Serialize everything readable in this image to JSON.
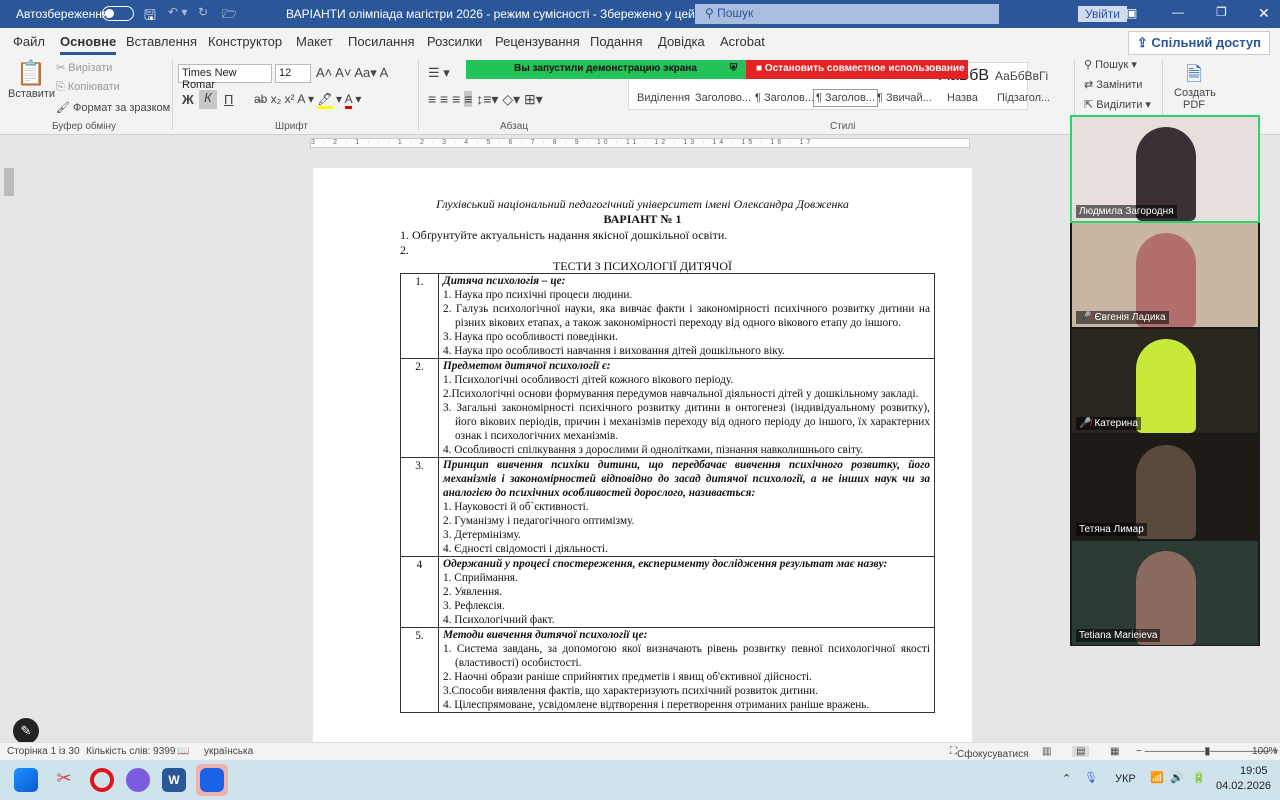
{
  "titlebar": {
    "autosave": "Автозбереження",
    "doc_title": "ВАРІАНТИ олімпіада  магістри 2026  -  режим сумісності  -  Збережено у цей ПК ▾",
    "search_placeholder": "Пошук",
    "login": "Увійти"
  },
  "tabs": [
    "Файл",
    "Основне",
    "Вставлення",
    "Конструктор",
    "Макет",
    "Посилання",
    "Розсилки",
    "Рецензування",
    "Подання",
    "Довідка",
    "Acrobat"
  ],
  "share": "Спільний доступ",
  "ribbon": {
    "paste": "Вставити",
    "cut": "Вирізати",
    "copy": "Копіювати",
    "format_painter": "Формат за зразком",
    "clipboard": "Буфер обміну",
    "font_name": "Times New Romar",
    "font_size": "12",
    "font_group": "Шрифт",
    "paragraph_group": "Абзац",
    "styles_group": "Стилі",
    "styles": [
      "Виділення",
      "Заголово...",
      "¶ Заголов...",
      "¶ Заголов...",
      "¶ Звичай...",
      "Назва",
      "Підзагол..."
    ],
    "style_sample_name": "АаБбВ",
    "style_sample_sub": "АаБбВвГі",
    "find": "Пошук",
    "replace": "Замінити",
    "select": "Виділити",
    "create_pdf": "Создать PDF",
    "bold": "Ж",
    "italic": "К",
    "underline": "П"
  },
  "screenshare": {
    "sharing_msg": "Вы запустили демонстрацию экрана",
    "stop": "Остановить совместное использование"
  },
  "ruler": "3 · 2 · 1 · · · 1 · 2 · 3 · 4 · 5 · 6 · 7 · 8 · 9 · 10 · 11 · 12 · 13 · 14 · 15 · 16 · 17",
  "document": {
    "university": "Глухівський національний педагогічний  університет імені Олександра Довженка",
    "variant": "ВАРІАНТ  № 1",
    "task1": "1. Обґрунтуйте актуальність надання якісної дошкільної освіти.",
    "task2": "2.",
    "section": "ТЕСТИ З ПСИХОЛОГІЇ ДИТЯЧОЇ",
    "questions": [
      {
        "num": "1.",
        "q": "Дитяча психологія – це:",
        "options": [
          "1. Наука про психічні процеси людини.",
          "2. Галузь психологічної науки, яка вивчає факти і закономірності психічного розвитку дитини на різних вікових етапах, а також закономірності переходу від одного вікового етапу до іншого.",
          "3. Наука про особливості поведінки.",
          "4. Наука про особливості навчання і виховання дітей дошкільного віку."
        ]
      },
      {
        "num": "2.",
        "q": "Предметом дитячої психології є:",
        "options": [
          "1. Психологічні особливості дітей кожного вікового періоду.",
          "2.Психологічні основи формування передумов навчальної діяльності дітей у дошкільному закладі.",
          "3. Загальні закономірності психічного розвитку дитини в онтогенезі (індивідуальному розвитку), його вікових періодів, причин і механізмів переходу від одного періоду до іншого, їх характерних ознак і психологічних механізмів.",
          "4. Особливості спілкування з дорослими й однолітками, пізнання навколишнього світу."
        ]
      },
      {
        "num": "3.",
        "q": "Принцип вивчення психіки дитини, що передбачає вивчення психічного розвитку, його механізмів і закономірностей відповідно до засад дитячої психології, а не інших наук чи за аналогією до психічних особливостей дорослого, називається:",
        "options": [
          "1. Науковості й об`єктивності.",
          "2. Гуманізму і педагогічного оптимізму.",
          "3. Детермінізму.",
          "4. Єдності свідомості і діяльності."
        ]
      },
      {
        "num": "4",
        "q": "Одержаний у процесі спостереження, експерименту дослідження результат має назву:",
        "options": [
          "1. Сприймання.",
          "2. Уявлення.",
          "3. Рефлексія.",
          "4. Психологічний факт."
        ]
      },
      {
        "num": "5.",
        "q": "Методи вивчення дитячої психології це:",
        "options": [
          "1. Система завдань, за допомогою якої визначають рівень розвитку певної психологічної якості (властивості) особистості.",
          "2. Наочні образи раніше сприйнятих предметів і явищ об'єктивної дійсності.",
          "3.Способи виявлення фактів, що характеризують психічний розвиток дитини.",
          "4. Цілеспрямоване, усвідомлене відтворення і перетворення отриманих раніше вражень."
        ]
      }
    ]
  },
  "participants": [
    {
      "name": "Людмила Загородня",
      "muted": false,
      "bg": "#e9dede",
      "face": "#3a3036"
    },
    {
      "name": "Євгенія Ладика",
      "muted": true,
      "bg": "#c9b7a4",
      "face": "#b26f6c"
    },
    {
      "name": "Катерина",
      "muted": true,
      "bg": "#2a2620",
      "face": "#c8e83a"
    },
    {
      "name": "Тетяна Лимар",
      "muted": false,
      "bg": "#1e1a16",
      "face": "#5a4a3e"
    },
    {
      "name": "Tetiana Marieieva",
      "muted": false,
      "bg": "#2b3a33",
      "face": "#8a6a5e"
    }
  ],
  "status": {
    "page": "Сторінка 1 із 30",
    "words": "Кількість слів: 9399",
    "language": "українська",
    "focus": "Сфокусуватися",
    "zoom": "100%"
  },
  "tray": {
    "lang": "УКР",
    "time": "19:05",
    "date": "04.02.2026"
  },
  "colors": {
    "word_blue": "#2b579a",
    "share_green": "#23c35a",
    "stop_red": "#e32323"
  }
}
